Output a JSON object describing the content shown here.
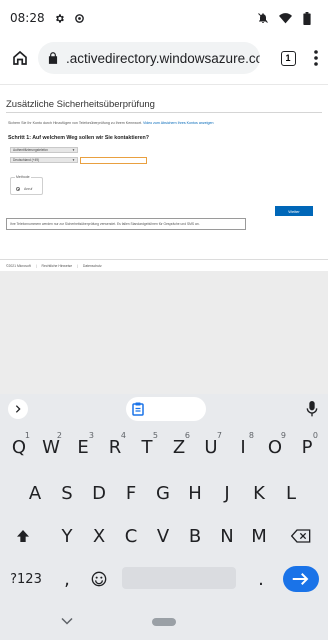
{
  "status_bar": {
    "time": "08:28"
  },
  "browser": {
    "url": ".activedirectory.windowsazure.com",
    "tab_count": "1"
  },
  "page": {
    "title": "Zusätzliche Sicherheitsüberprüfung",
    "intro_text": "Sichern Sie Ihr Konto durch Hinzufügen von Telefonüberprüfung zu Ihrem Kennwort.",
    "intro_link": "Video zum Absichern Ihres Kontos anzeigen",
    "step_title": "Schritt 1: Auf welchem Weg sollen wir Sie kontaktieren?",
    "contact_select": "Authentifizierungstelefon",
    "country_select": "Deutschland (+49)",
    "phone_value": "",
    "method_legend": "Methode",
    "method_option": "Anruf",
    "next_button": "Weiter",
    "notice": "Ihre Telefonnummern werden nur zur Sicherheitsüberprüfung verwendet. Es fallen Standardgebühren für Gespräche und SMS an.",
    "footer": {
      "copyright": "©2021 Microsoft",
      "legal": "Rechtliche Hinweise",
      "privacy": "Datenschutz"
    }
  },
  "keyboard": {
    "row1": [
      {
        "k": "Q",
        "h": "1"
      },
      {
        "k": "W",
        "h": "2"
      },
      {
        "k": "E",
        "h": "3"
      },
      {
        "k": "R",
        "h": "4"
      },
      {
        "k": "T",
        "h": "5"
      },
      {
        "k": "Z",
        "h": "6"
      },
      {
        "k": "U",
        "h": "7"
      },
      {
        "k": "I",
        "h": "8"
      },
      {
        "k": "O",
        "h": "9"
      },
      {
        "k": "P",
        "h": "0"
      }
    ],
    "row2": [
      "A",
      "S",
      "D",
      "F",
      "G",
      "H",
      "J",
      "K",
      "L"
    ],
    "row3": [
      "Y",
      "X",
      "C",
      "V",
      "B",
      "N",
      "M"
    ],
    "symbols_key": "?123",
    "comma_key": ",",
    "period_key": "."
  }
}
